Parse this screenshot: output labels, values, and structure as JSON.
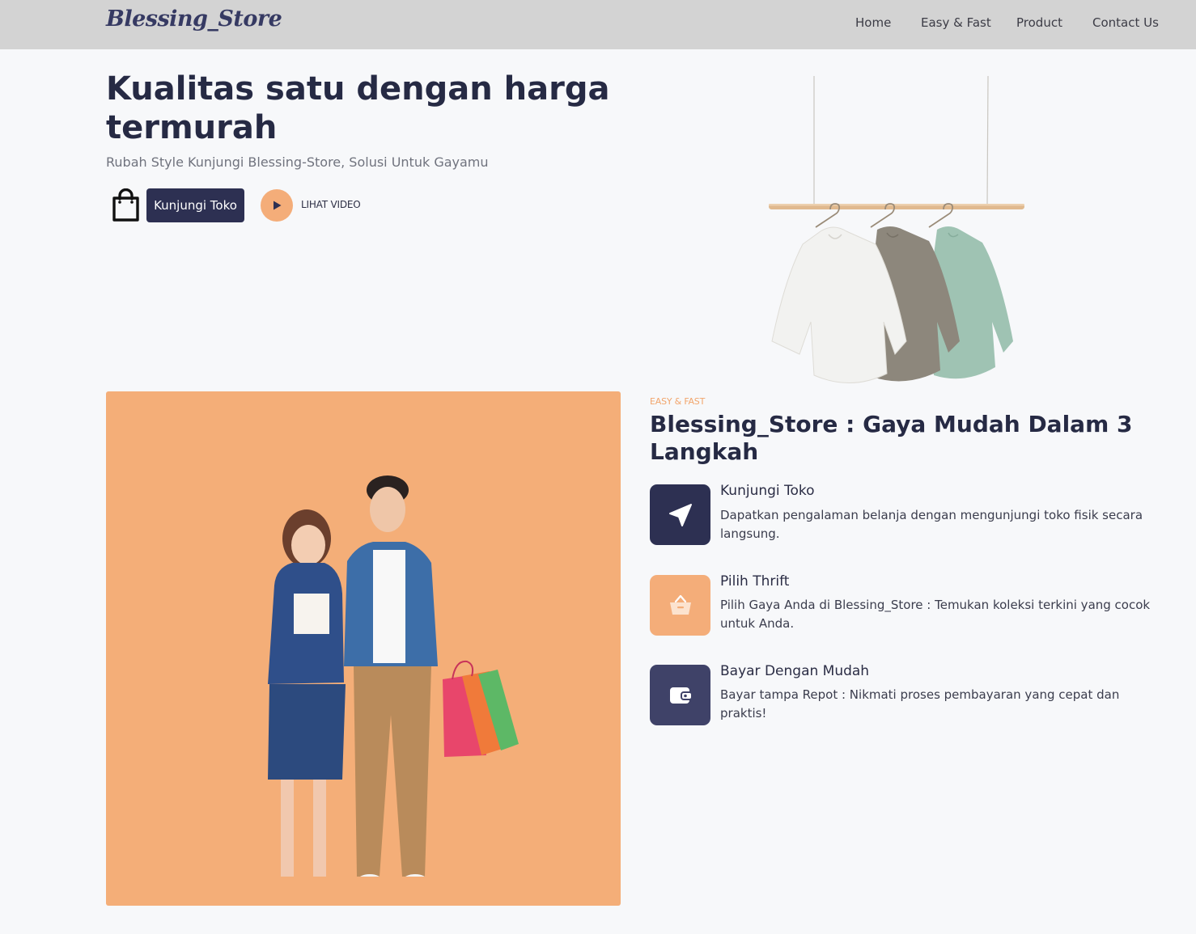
{
  "nav": {
    "logo": "Blessing_Store",
    "links": [
      "Home",
      "Easy & Fast",
      "Product",
      "Contact Us"
    ]
  },
  "hero": {
    "title": "Kualitas satu dengan harga termurah",
    "subtitle": "Rubah Style Kunjungi Blessing-Store, Solusi Untuk Gayamu",
    "visit_button": "Kunjungi Toko",
    "video_label": "LIHAT VIDEO"
  },
  "steps": {
    "eyebrow": "EASY & FAST",
    "title": "Blessing_Store : Gaya Mudah Dalam 3 Langkah",
    "items": [
      {
        "title": "Kunjungi Toko",
        "desc": "Dapatkan pengalaman belanja dengan mengunjungi toko fisik secara langsung.",
        "icon": "send-icon",
        "color": "#2d3052"
      },
      {
        "title": "Pilih Thrift",
        "desc": "Pilih Gaya Anda di Blessing_Store : Temukan koleksi terkini yang cocok untuk Anda.",
        "icon": "basket-icon",
        "color": "#f4ad79"
      },
      {
        "title": "Bayar Dengan Mudah",
        "desc": "Bayar tampa Repot : Nikmati proses pembayaran yang cepat dan praktis!",
        "icon": "wallet-icon",
        "color": "#3f4268"
      }
    ]
  },
  "colors": {
    "navy": "#2d3052",
    "accent": "#f4ad79",
    "navbar": "#d3d3d3",
    "background": "#f7f8fa"
  }
}
